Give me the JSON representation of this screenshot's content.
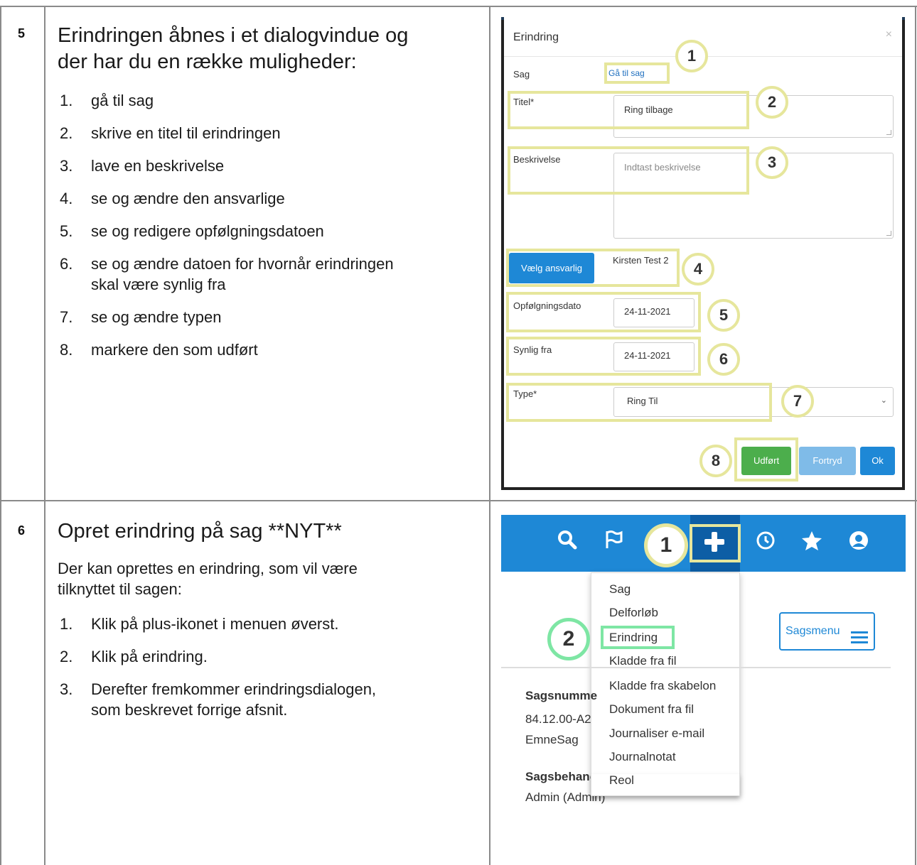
{
  "step5": {
    "number": "5",
    "title_line1": "Erindringen åbnes i et dialogvindue og",
    "title_line2": "der har du en række muligheder:",
    "items": [
      {
        "n": "1.",
        "text": "gå til sag"
      },
      {
        "n": "2.",
        "text": "skrive en titel til erindringen"
      },
      {
        "n": "3.",
        "text": "lave en beskrivelse"
      },
      {
        "n": "4.",
        "text": "se og ændre den ansvarlige"
      },
      {
        "n": "5.",
        "text": "se og redigere opfølgningsdatoen"
      },
      {
        "n": "6.",
        "text": "se og ændre datoen for hvornår erindringen",
        "text2": "skal være synlig fra"
      },
      {
        "n": "7.",
        "text": "se og ændre typen"
      },
      {
        "n": "8.",
        "text": "markere den som udført"
      }
    ]
  },
  "dialog": {
    "title": "Erindring",
    "close": "×",
    "sag_label": "Sag",
    "sag_link": "Gå til sag",
    "titel_label": "Titel*",
    "titel_value": "Ring tilbage",
    "beskrivelse_label": "Beskrivelse",
    "beskrivelse_placeholder": "Indtast beskrivelse",
    "ansvarlig_button": "Vælg ansvarlig",
    "ansvarlig_value": "Kirsten Test 2",
    "opfolgning_label": "Opfølgningsdato",
    "opfolgning_value": "24-11-2021",
    "synlig_label": "Synlig fra",
    "synlig_value": "24-11-2021",
    "type_label": "Type*",
    "type_value": "Ring Til",
    "udfoert_button": "Udført",
    "fortryd_button": "Fortryd",
    "ok_button": "Ok",
    "badges": [
      "1",
      "2",
      "3",
      "4",
      "5",
      "6",
      "7",
      "8"
    ]
  },
  "step6": {
    "number": "6",
    "title": "Opret erindring på sag **NYT**",
    "desc_line1": "Der kan oprettes en erindring, som vil være",
    "desc_line2": "tilknyttet til sagen:",
    "items": [
      {
        "n": "1.",
        "text": "Klik på plus-ikonet i menuen øverst."
      },
      {
        "n": "2.",
        "text": "Klik på erindring."
      },
      {
        "n": "3.",
        "text": "Derefter fremkommer erindringsdialogen,",
        "text2": "som beskrevet forrige afsnit."
      }
    ]
  },
  "menu_shot": {
    "badge1": "1",
    "badge2": "2",
    "items": [
      "Sag",
      "Delforløb",
      "Erindring",
      "Kladde fra fil",
      "Kladde fra skabelon",
      "Dokument fra fil",
      "Journaliser e-mail",
      "Journalnotat",
      "Reol"
    ],
    "sagsmenu": "Sagsmenu",
    "sagsnummer_label": "Sagsnumme",
    "sagsnummer_value": "84.12.00-A2",
    "emne": "EmneSag",
    "sagsbehandler_label": "Sagsbehanc",
    "sagsbehandler_value": "Admin (Admin)"
  },
  "colors": {
    "highlight": "#e6e69c",
    "green_highlight": "#7ee6a4",
    "blue": "#1e88d6",
    "green_button": "#4cae4c"
  }
}
